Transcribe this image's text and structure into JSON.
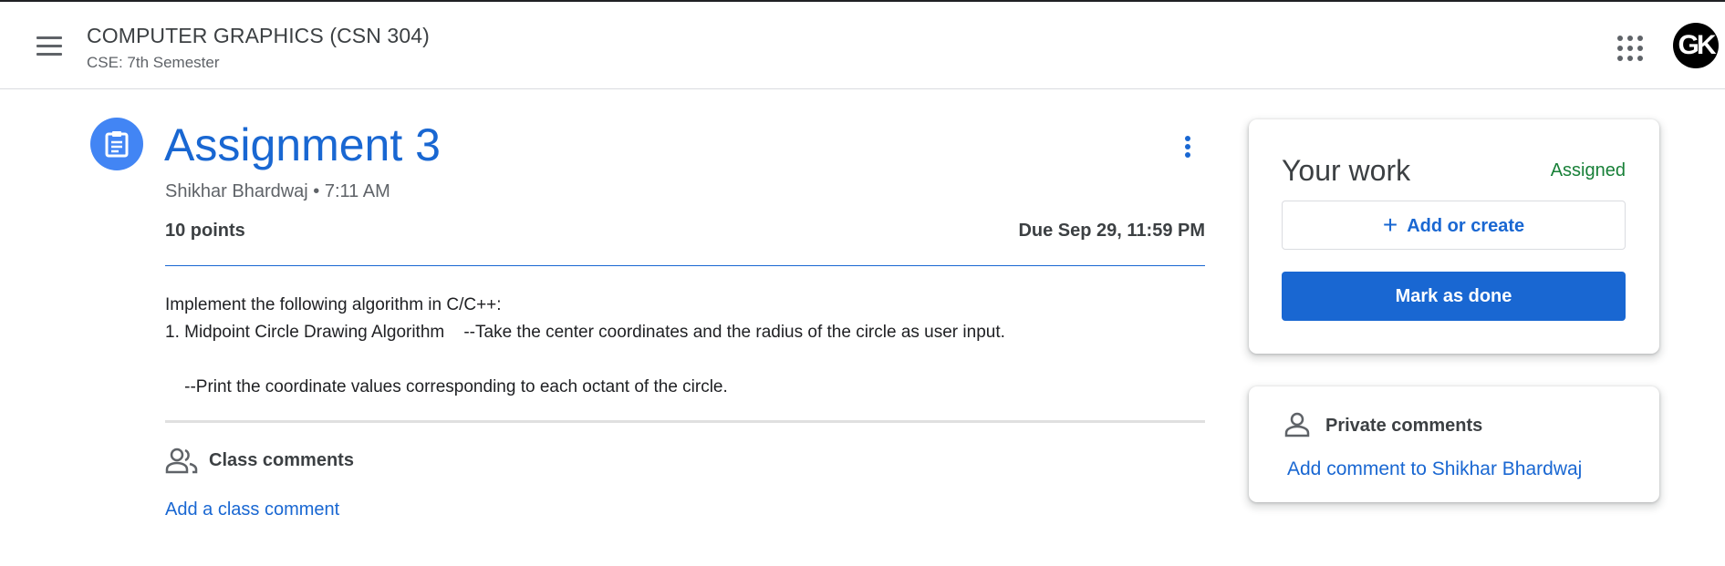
{
  "header": {
    "class_title": "COMPUTER GRAPHICS (CSN 304)",
    "class_section": "CSE: 7th Semester",
    "avatar_initials": "GK",
    "icons": [
      "menu-icon",
      "apps-grid-icon"
    ]
  },
  "assignment": {
    "title": "Assignment 3",
    "author_time": "Shikhar Bhardwaj • 7:11 AM",
    "points": "10 points",
    "due": "Due Sep 29, 11:59 PM",
    "description": "Implement the following algorithm in C/C++:\n1. Midpoint Circle Drawing Algorithm    --Take the center coordinates and the radius of the circle as user input.\n\n    --Print the coordinate values corresponding to each octant of the circle.",
    "icons": [
      "assignment-icon",
      "more-vert-icon"
    ]
  },
  "class_comments": {
    "label": "Class comments",
    "add_link": "Add a class comment",
    "icon": "people-icon"
  },
  "your_work": {
    "title": "Your work",
    "status": "Assigned",
    "add_button": "Add or create",
    "add_icon": "+",
    "done_button": "Mark as done"
  },
  "private_comments": {
    "label": "Private comments",
    "add_link": "Add comment to Shikhar Bhardwaj",
    "icon": "person-icon"
  },
  "colors": {
    "accent": "#1967d2",
    "icon_circle": "#4285f4",
    "status_assigned": "#188038"
  }
}
